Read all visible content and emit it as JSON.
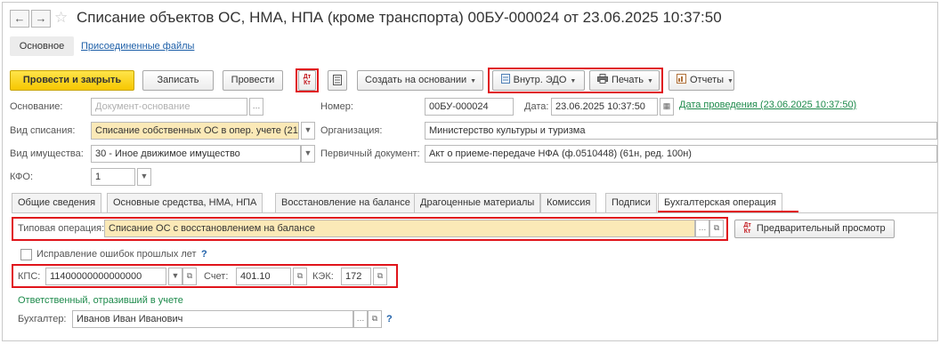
{
  "window": {
    "title": "Списание объектов ОС, НМА, НПА (кроме транспорта) 00БУ-000024 от 23.06.2025 10:37:50",
    "back_symbol": "←",
    "forward_symbol": "→",
    "star_symbol": "☆"
  },
  "subtabs": {
    "main": "Основное",
    "attached": "Присоединенные файлы"
  },
  "toolbar": {
    "post_close": "Провести и закрыть",
    "save": "Записать",
    "post": "Провести",
    "dtkt_dt": "Дт",
    "dtkt_kt": "Кт",
    "create_basis": "Создать на основании",
    "edo": "Внутр. ЭДО",
    "print": "Печать",
    "reports": "Отчеты"
  },
  "form": {
    "basis_label": "Основание:",
    "basis_placeholder": "Документ-основание",
    "writeoff_label": "Вид списания:",
    "writeoff_value": "Списание собственных ОС в опер. учете (21",
    "property_label": "Вид имущества:",
    "property_value": "30 - Иное движимое имущество",
    "kfo_label": "КФО:",
    "kfo_value": "1",
    "number_label": "Номер:",
    "number_value": "00БУ-000024",
    "date_label": "Дата:",
    "date_value": "23.06.2025 10:37:50",
    "posting_date_link": "Дата проведения (23.06.2025 10:37:50)",
    "org_label": "Организация:",
    "org_value": "Министерство культуры и туризма",
    "primary_doc_label": "Первичный документ:",
    "primary_doc_value": "Акт о приеме-передаче НФА (ф.0510448) (61н, ред. 100н)"
  },
  "tabs": [
    "Общие сведения",
    "Основные средства, НМА, НПА",
    "Восстановление на балансе",
    "Драгоценные материалы",
    "Комиссия",
    "Подписи",
    "Бухгалтерская операция"
  ],
  "accounting": {
    "typical_op_label": "Типовая операция:",
    "typical_op_value": "Списание ОС с восстановлением на балансе",
    "preview_button": "Предварительный просмотр",
    "fix_errors_label": "Исправление ошибок прошлых лет",
    "help_mark": "?",
    "kps_label": "КПС:",
    "kps_value": "11400000000000000",
    "account_label": "Счет:",
    "account_value": "401.10",
    "kek_label": "КЭК:",
    "kek_value": "172",
    "responsible_caption": "Ответственный, отразивший в учете",
    "accountant_label": "Бухгалтер:",
    "accountant_value": "Иванов Иван Иванович"
  },
  "colors": {
    "accent_red": "#e0141b",
    "primary_yellow": "#f6c700",
    "link_green": "#1d8a4b",
    "link_blue": "#1d5fa8"
  }
}
